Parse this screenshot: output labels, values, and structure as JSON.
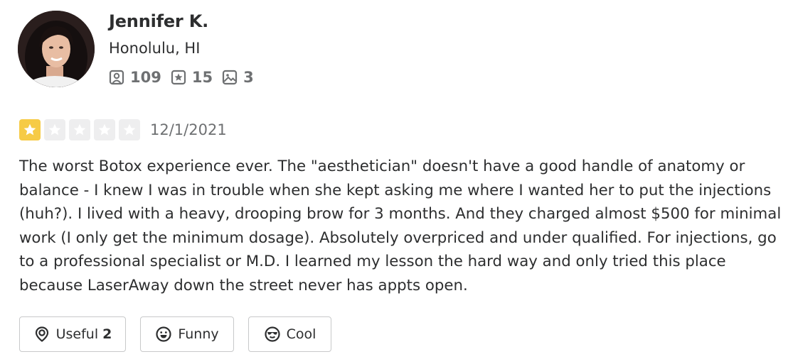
{
  "reviewer": {
    "name": "Jennifer K.",
    "location": "Honolulu, HI",
    "avatar_icon": "profile-photo",
    "stats": {
      "friends": "109",
      "reviews": "15",
      "photos": "3"
    }
  },
  "review": {
    "rating": 1,
    "max_rating": 5,
    "date": "12/1/2021",
    "text": "The worst Botox experience ever. The \"aesthetician\" doesn't have a good handle of anatomy or balance - I knew I was in trouble when she kept asking me where I wanted her to put the injections (huh?). I lived with a heavy, drooping brow for 3 months. And they charged almost $500 for minimal work (I only get the minimum dosage). Absolutely overpriced and under qualified. For injections, go to a professional specialist or M.D. I learned my lesson the hard way and only tried this place because LaserAway down the street never has appts open."
  },
  "reactions": {
    "useful": {
      "label": "Useful",
      "count": "2"
    },
    "funny": {
      "label": "Funny"
    },
    "cool": {
      "label": "Cool"
    }
  },
  "colors": {
    "text": "#2d2e2f",
    "muted": "#6e7072",
    "star_filled": "#f6cb46",
    "star_empty": "#eeeeef",
    "button_border": "#c8c9ca"
  }
}
